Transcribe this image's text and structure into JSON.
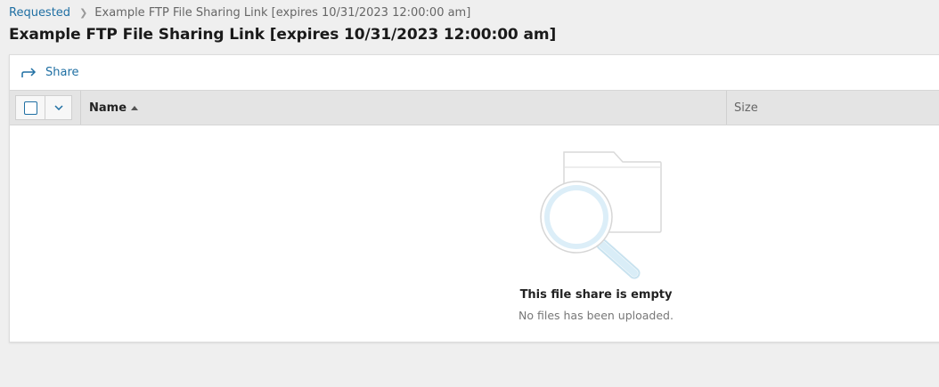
{
  "breadcrumb": {
    "parent": "Requested",
    "current": "Example FTP File Sharing Link [expires 10/31/2023 12:00:00 am]"
  },
  "page": {
    "title": "Example FTP File Sharing Link [expires 10/31/2023 12:00:00 am]"
  },
  "toolbar": {
    "share_label": "Share",
    "share_icon": "share-arrow-icon"
  },
  "table": {
    "columns": [
      {
        "label": "Name",
        "sorted": "ascending"
      },
      {
        "label": "Size"
      }
    ],
    "rows": []
  },
  "empty_state": {
    "title": "This file share is empty",
    "subtitle": "No files has been uploaded.",
    "icon": "folder-search-icon"
  },
  "colors": {
    "accent": "#1f6fa3",
    "background": "#efefef",
    "header_bg": "#e4e4e4"
  }
}
